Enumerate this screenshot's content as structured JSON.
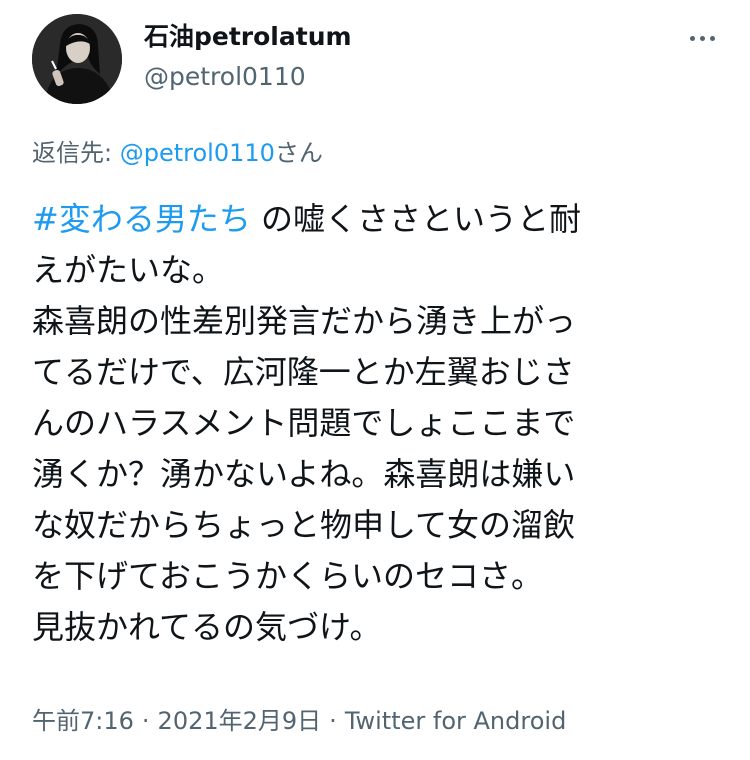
{
  "author": {
    "display_name": "石油petrolatum",
    "handle": "@petrol0110"
  },
  "more_icon": "more-horizontal-icon",
  "reply": {
    "prefix": "返信先: ",
    "mention": "@petrol0110",
    "suffix": "さん"
  },
  "tweet": {
    "hashtag": "#変わる男たち",
    "line1_rest": " の嘘くささというと耐",
    "lines": [
      "えがたいな。",
      "森喜朗の性差別発言だから湧き上がっ",
      "てるだけで、広河隆一とか左翼おじさ",
      "んのハラスメント問題でしょここまで",
      "湧くか？湧かないよね。森喜朗は嫌い",
      "な奴だからちょっと物申して女の溜飲",
      "を下げておこうかくらいのセコさ。",
      "見抜かれてるの気づけ。"
    ]
  },
  "meta": {
    "time": "午前7:16",
    "separator": "·",
    "date": "2021年2月9日",
    "source": "Twitter for Android"
  },
  "colors": {
    "link": "#1d9bf0",
    "secondary": "#536471",
    "text": "#0f1419"
  }
}
